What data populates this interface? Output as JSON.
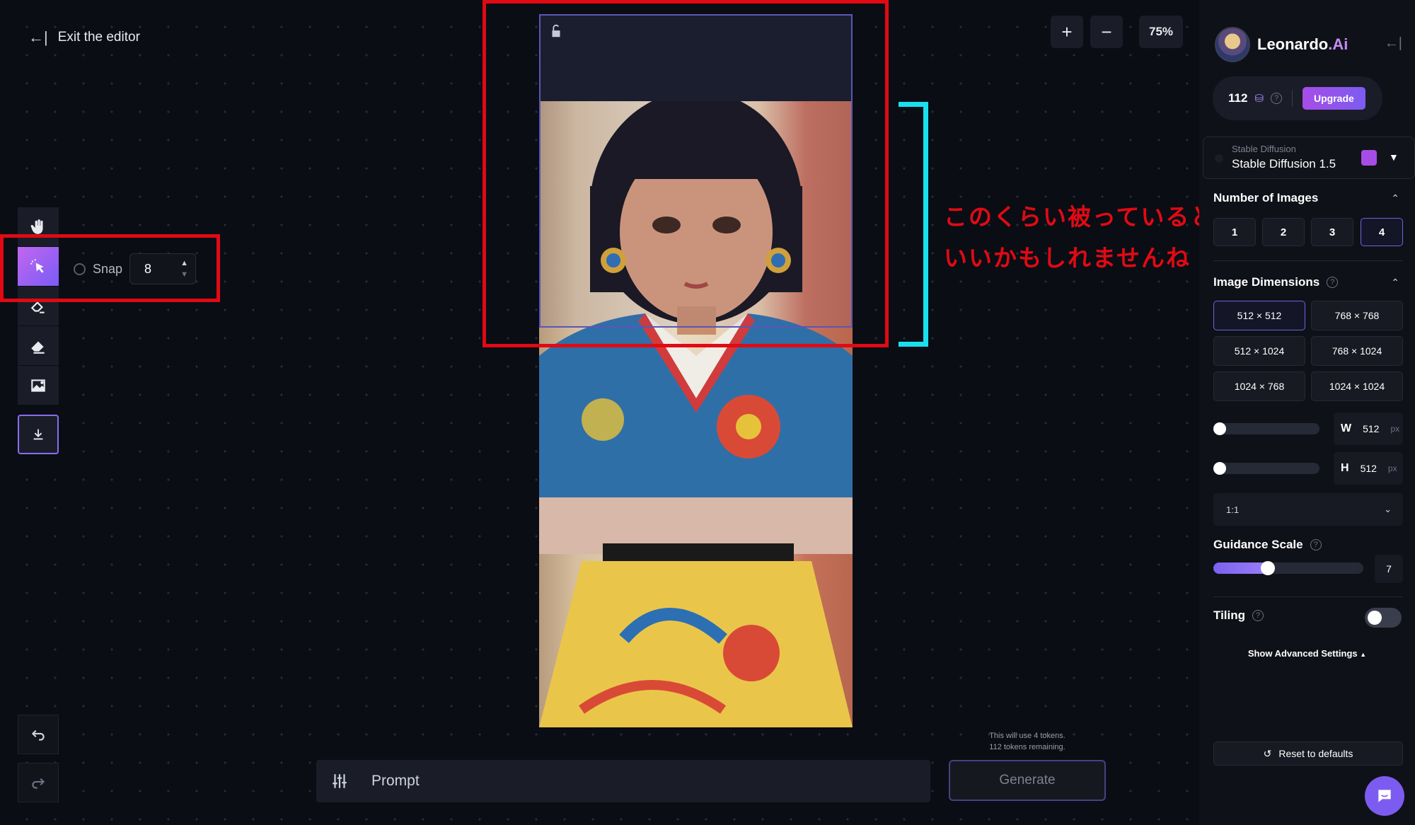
{
  "editor": {
    "exit_label": "Exit the editor",
    "zoom_in": "+",
    "zoom_out": "−",
    "zoom_level": "75%",
    "snap_label": "Snap",
    "snap_value": "8",
    "prompt_placeholder": "Prompt",
    "generate_label": "Generate",
    "tokens_line1": "This will use 4 tokens.",
    "tokens_line2": "112 tokens remaining."
  },
  "annotation": {
    "line1": "このくらい被っていると",
    "line2": "いいかもしれませんね",
    "box_color": "#e00a14",
    "bracket_color": "#19e0ef"
  },
  "tools": [
    "hand-icon",
    "select-icon",
    "mask-icon",
    "eraser-icon",
    "image-icon",
    "download-icon"
  ],
  "panel": {
    "brand": "Leonardo",
    "brand_suffix": ".Ai",
    "credits": "112",
    "upgrade_label": "Upgrade",
    "model_sub": "Stable Diffusion",
    "model_main": "Stable Diffusion 1.5",
    "num_images_title": "Number of Images",
    "num_images": [
      "1",
      "2",
      "3",
      "4"
    ],
    "num_images_selected": "4",
    "dimensions_title": "Image Dimensions",
    "dimensions": [
      "512 × 512",
      "768 × 768",
      "512 × 1024",
      "768 × 1024",
      "1024 × 768",
      "1024 × 1024"
    ],
    "dimension_selected": "512 × 512",
    "width_label": "W",
    "width_value": "512",
    "height_label": "H",
    "height_value": "512",
    "unit": "px",
    "aspect_ratio": "1:1",
    "guidance_title": "Guidance Scale",
    "guidance_value": "7",
    "tiling_title": "Tiling",
    "tiling_on": false,
    "advanced_label": "Show Advanced Settings",
    "reset_label": "Reset to defaults",
    "accent": "#7c5cf0"
  }
}
